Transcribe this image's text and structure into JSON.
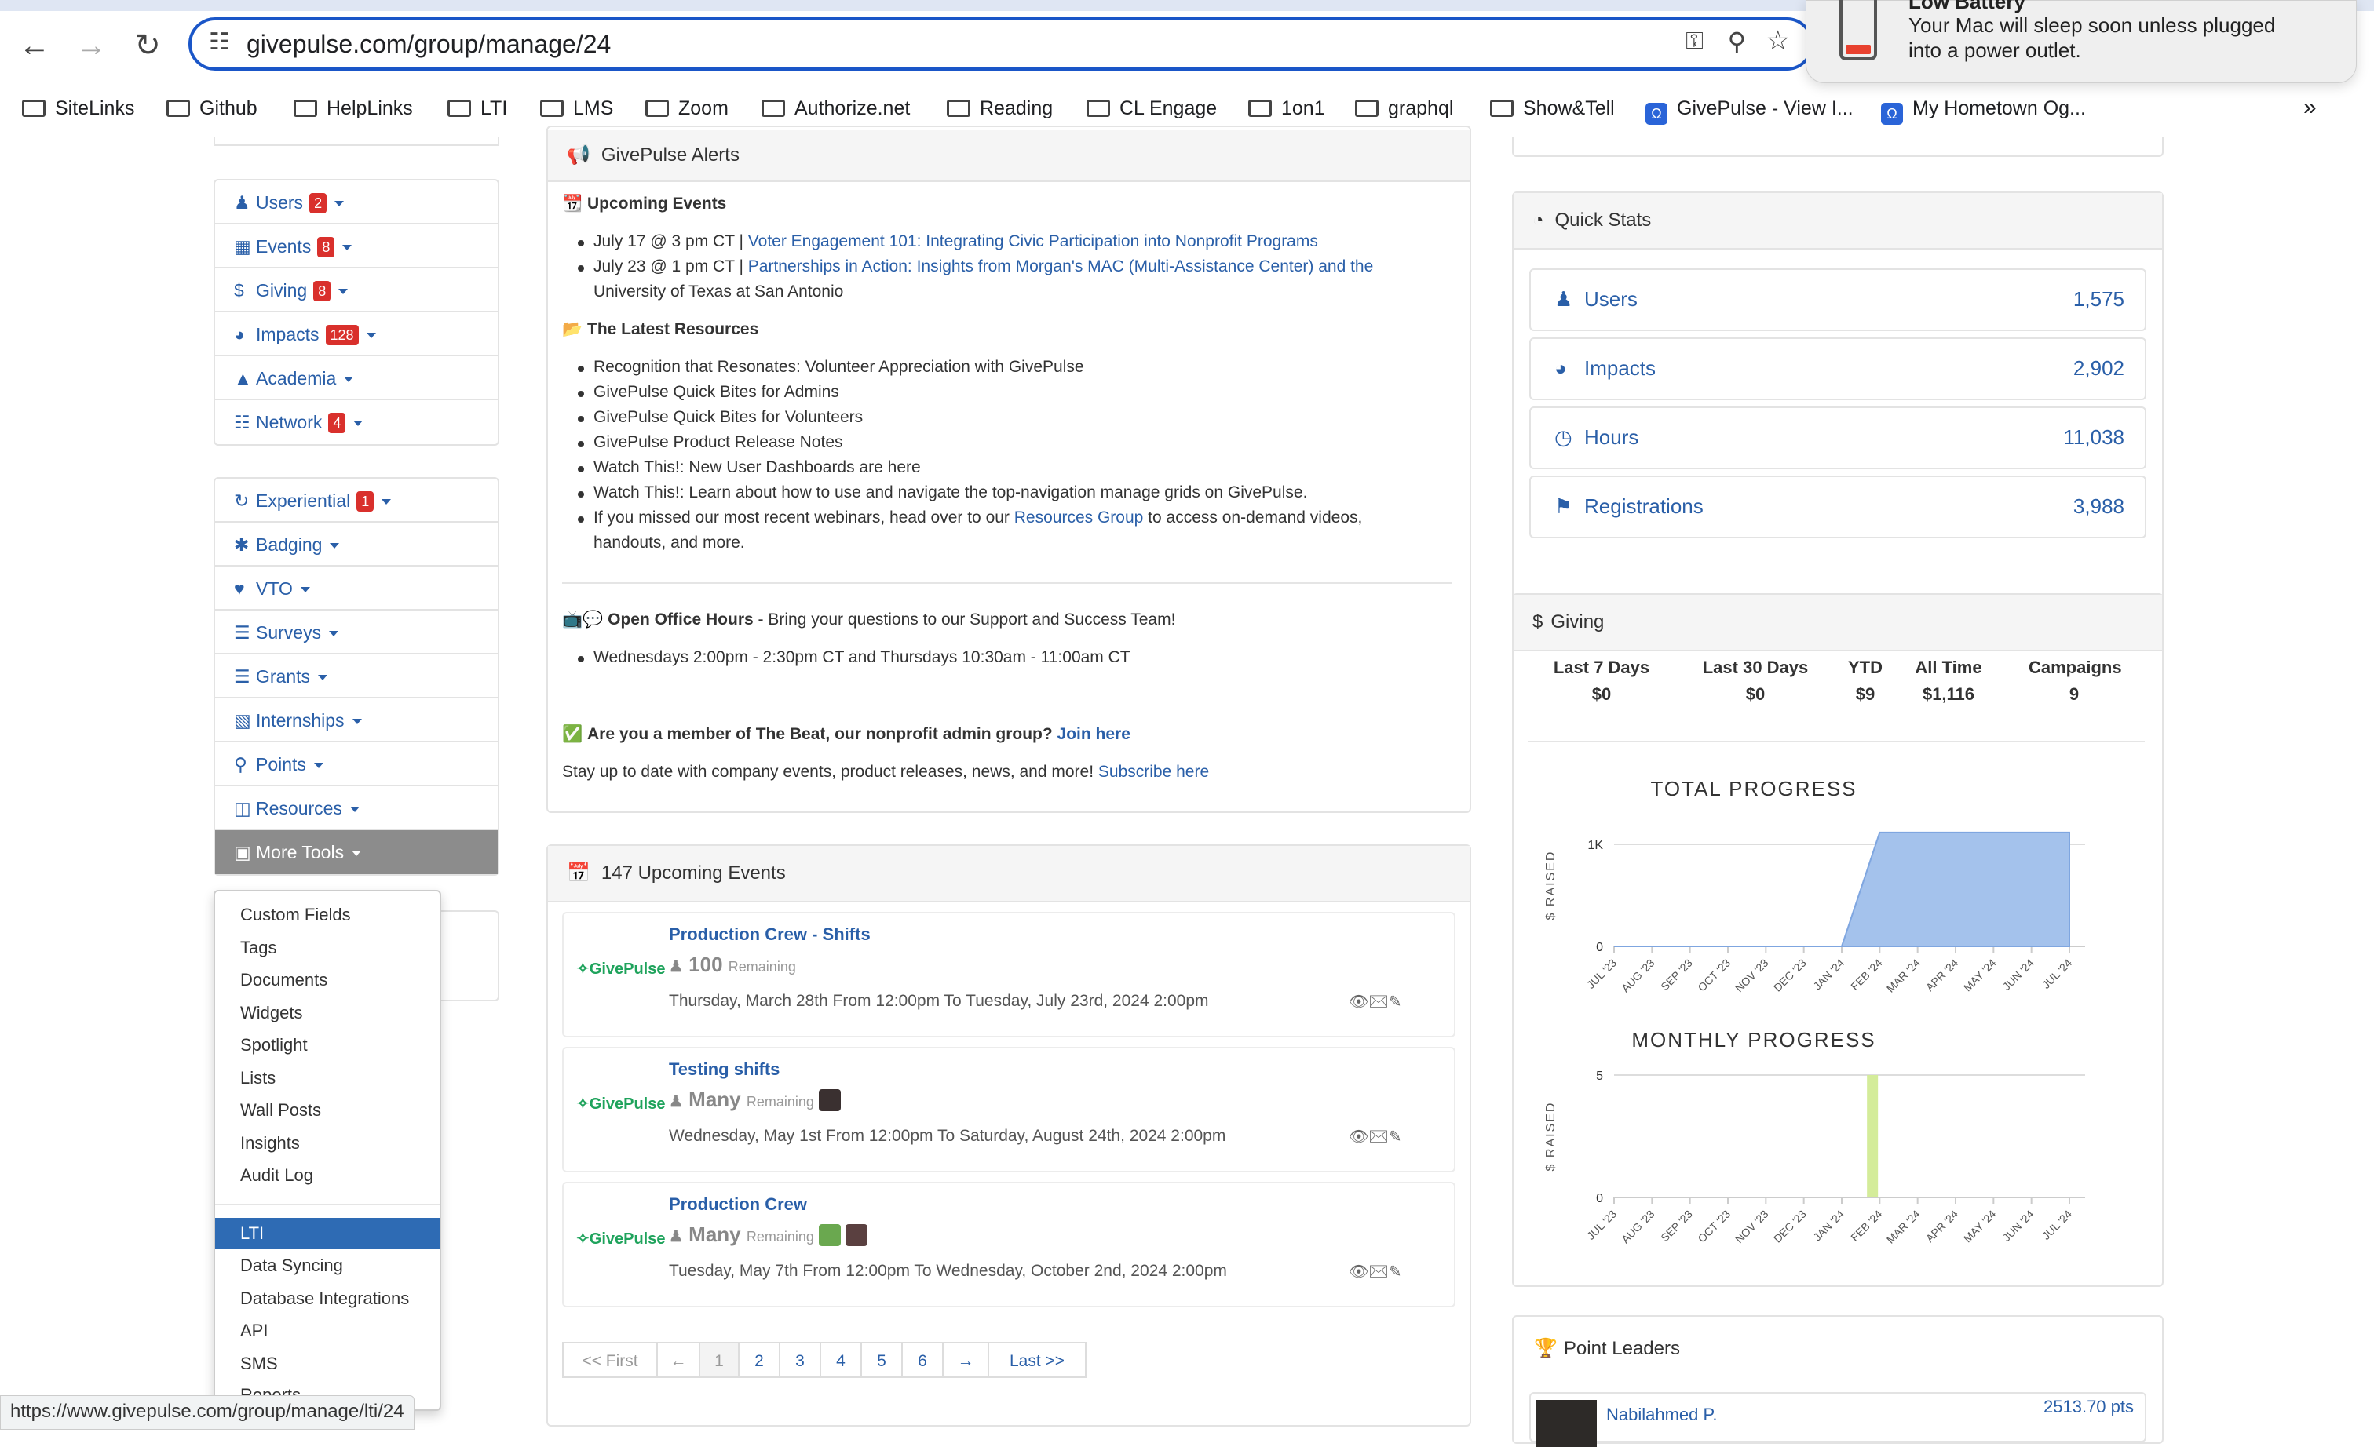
{
  "browser": {
    "url": "givepulse.com/group/manage/24",
    "bookmarks": [
      "SiteLinks",
      "Github",
      "HelpLinks",
      "LTI",
      "LMS",
      "Zoom",
      "Authorize.net",
      "Reading",
      "CL Engage",
      "1on1",
      "graphql",
      "Show&Tell",
      "GivePulse - View I...",
      "My Hometown Og..."
    ],
    "status_url": "https://www.givepulse.com/group/manage/lti/24"
  },
  "notification": {
    "title": "Low Battery",
    "body_line1": "Your Mac will sleep soon unless plugged",
    "body_line2": "into a power outlet."
  },
  "sidebar": {
    "group1": [
      {
        "label": "Users",
        "badge": "2",
        "icon": "user-icon"
      },
      {
        "label": "Events",
        "badge": "8",
        "icon": "calendar-icon"
      },
      {
        "label": "Giving",
        "badge": "8",
        "icon": "dollar-icon"
      },
      {
        "label": "Impacts",
        "badge": "128",
        "icon": "dashboard-icon"
      },
      {
        "label": "Academia",
        "badge": "",
        "icon": "graduation-cap-icon"
      },
      {
        "label": "Network",
        "badge": "4",
        "icon": "sitemap-icon"
      }
    ],
    "group2": [
      {
        "label": "Experiential",
        "badge": "1",
        "icon": "refresh-icon"
      },
      {
        "label": "Badging",
        "badge": "",
        "icon": "asterisk-icon"
      },
      {
        "label": "VTO",
        "badge": "",
        "icon": "heart-icon"
      },
      {
        "label": "Surveys",
        "badge": "",
        "icon": "list-icon"
      },
      {
        "label": "Grants",
        "badge": "",
        "icon": "list-icon"
      },
      {
        "label": "Internships",
        "badge": "",
        "icon": "briefcase-icon"
      },
      {
        "label": "Points",
        "badge": "",
        "icon": "trophy-icon"
      },
      {
        "label": "Resources",
        "badge": "",
        "icon": "folder-open-icon"
      },
      {
        "label": "More Tools",
        "badge": "",
        "icon": "toolbox-icon"
      }
    ],
    "more_tools_menu": [
      "Custom Fields",
      "Tags",
      "Documents",
      "Widgets",
      "Spotlight",
      "Lists",
      "Wall Posts",
      "Insights",
      "Audit Log",
      "LTI",
      "Data Syncing",
      "Database Integrations",
      "API",
      "SMS",
      "Reports"
    ]
  },
  "alerts": {
    "title": "GivePulse Alerts",
    "upcoming_heading": "Upcoming Events",
    "upcoming": [
      {
        "prefix": "July 17 @ 3 pm CT |",
        "link": "Voter Engagement 101: Integrating Civic Participation into Nonprofit Programs"
      },
      {
        "prefix": "July 23 @ 1 pm CT |",
        "link": "Partnerships in Action: Insights from Morgan's MAC (Multi-Assistance Center) and the",
        "link2": "University of Texas at San Antonio"
      }
    ],
    "resources_heading": "The Latest Resources",
    "resources": [
      "Recognition that Resonates: Volunteer Appreciation with GivePulse",
      "GivePulse Quick Bites for Admins",
      "GivePulse Quick Bites for Volunteers",
      "GivePulse Product Release Notes",
      "Watch This!: New User Dashboards are here",
      "Watch This!: Learn about how to use and navigate the top-navigation manage grids on GivePulse."
    ],
    "resources_note_pre": "If you missed our most recent webinars, head over to our",
    "resources_note_link": "Resources Group",
    "resources_note_post": "to access on-demand videos,",
    "resources_note_line2": "handouts, and more.",
    "office_heading": "Open Office Hours",
    "office_text": "- Bring your questions to our Support and Success Team!",
    "office_link": "Wednesdays 2:00pm - 2:30pm CT and Thursdays 10:30am - 11:00am CT",
    "beat_text": "Are you a member of The Beat, our nonprofit admin group?",
    "beat_link": "Join here",
    "stay_text": "Stay up to date with company events, product releases, news, and more!",
    "stay_link": "Subscribe here"
  },
  "events_panel": {
    "title": "147 Upcoming Events",
    "logo_text": "GivePulse",
    "remaining_label": "Remaining",
    "events": [
      {
        "title": "Production Crew - Shifts",
        "remaining": "100",
        "date": "Thursday, March 28th From 12:00pm To Tuesday, July 23rd, 2024 2:00pm"
      },
      {
        "title": "Testing shifts",
        "remaining": "Many",
        "date": "Wednesday, May 1st From 12:00pm To Saturday, August 24th, 2024 2:00pm"
      },
      {
        "title": "Production Crew",
        "remaining": "Many",
        "date": "Tuesday, May 7th From 12:00pm To Wednesday, October 2nd, 2024 2:00pm"
      }
    ],
    "pagination": [
      "<< First",
      "←",
      "1",
      "2",
      "3",
      "4",
      "5",
      "6",
      "→",
      "Last >>"
    ]
  },
  "quick_stats": {
    "title": "Quick Stats",
    "items": [
      {
        "label": "Users",
        "value": "1,575",
        "icon": "user-icon"
      },
      {
        "label": "Impacts",
        "value": "2,902",
        "icon": "dashboard-icon"
      },
      {
        "label": "Hours",
        "value": "11,038",
        "icon": "clock-icon"
      },
      {
        "label": "Registrations",
        "value": "3,988",
        "icon": "flag-icon"
      }
    ]
  },
  "giving": {
    "title": "Giving",
    "columns": [
      {
        "label": "Last 7 Days",
        "value": "$0"
      },
      {
        "label": "Last 30 Days",
        "value": "$0"
      },
      {
        "label": "YTD",
        "value": "$9"
      },
      {
        "label": "All Time",
        "value": "$1,116"
      },
      {
        "label": "Campaigns",
        "value": "9"
      }
    ]
  },
  "point_leaders": {
    "title": "Point Leaders",
    "leaders": [
      {
        "name": "Nabilahmed P.",
        "points": "2513.70 pts"
      }
    ]
  },
  "chart_data": [
    {
      "type": "area",
      "title": "TOTAL PROGRESS",
      "ylabel": "$ RAISED",
      "categories": [
        "JUL '23",
        "AUG '23",
        "SEP '23",
        "OCT '23",
        "NOV '23",
        "DEC '23",
        "JAN '24",
        "FEB '24",
        "MAR '24",
        "APR '24",
        "MAY '24",
        "JUN '24",
        "JUL '24"
      ],
      "values": [
        0,
        0,
        0,
        0,
        0,
        0,
        0,
        1116,
        1116,
        1116,
        1116,
        1116,
        1116
      ],
      "yticks": [
        "0",
        "1K"
      ],
      "ylim": [
        0,
        1200
      ],
      "color": "#a4c2ec"
    },
    {
      "type": "bar",
      "title": "MONTHLY PROGRESS",
      "ylabel": "$ RAISED",
      "categories": [
        "JUL '23",
        "AUG '23",
        "SEP '23",
        "OCT '23",
        "NOV '23",
        "DEC '23",
        "JAN '24",
        "FEB '24",
        "MAR '24",
        "APR '24",
        "MAY '24",
        "JUN '24",
        "JUL '24"
      ],
      "values": [
        0,
        0,
        0,
        0,
        0,
        0,
        0,
        5,
        0,
        0,
        0,
        0,
        0
      ],
      "yticks": [
        "0",
        "5"
      ],
      "ylim": [
        0,
        5
      ],
      "color": "#d4ec9a"
    }
  ]
}
